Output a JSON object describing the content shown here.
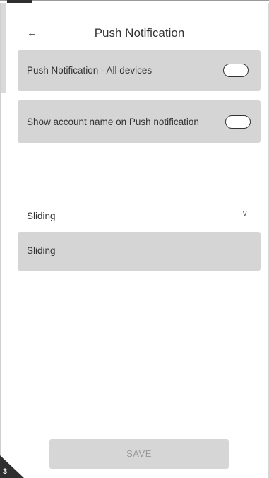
{
  "header": {
    "back_icon": "←",
    "title": "Push Notification"
  },
  "settings": [
    {
      "label": "Push Notification - All devices",
      "enabled": false
    },
    {
      "label": "Show account name on Push notification",
      "enabled": false
    }
  ],
  "mode": {
    "label": "Sliding",
    "chevron_icon": "v",
    "selected_value": "Sliding"
  },
  "actions": {
    "save_label": "SAVE"
  },
  "corner_badge": "3",
  "colors": {
    "card_bg": "#d5d5d5",
    "button_bg": "#d6d6d6",
    "button_text": "#9a9a9a"
  }
}
